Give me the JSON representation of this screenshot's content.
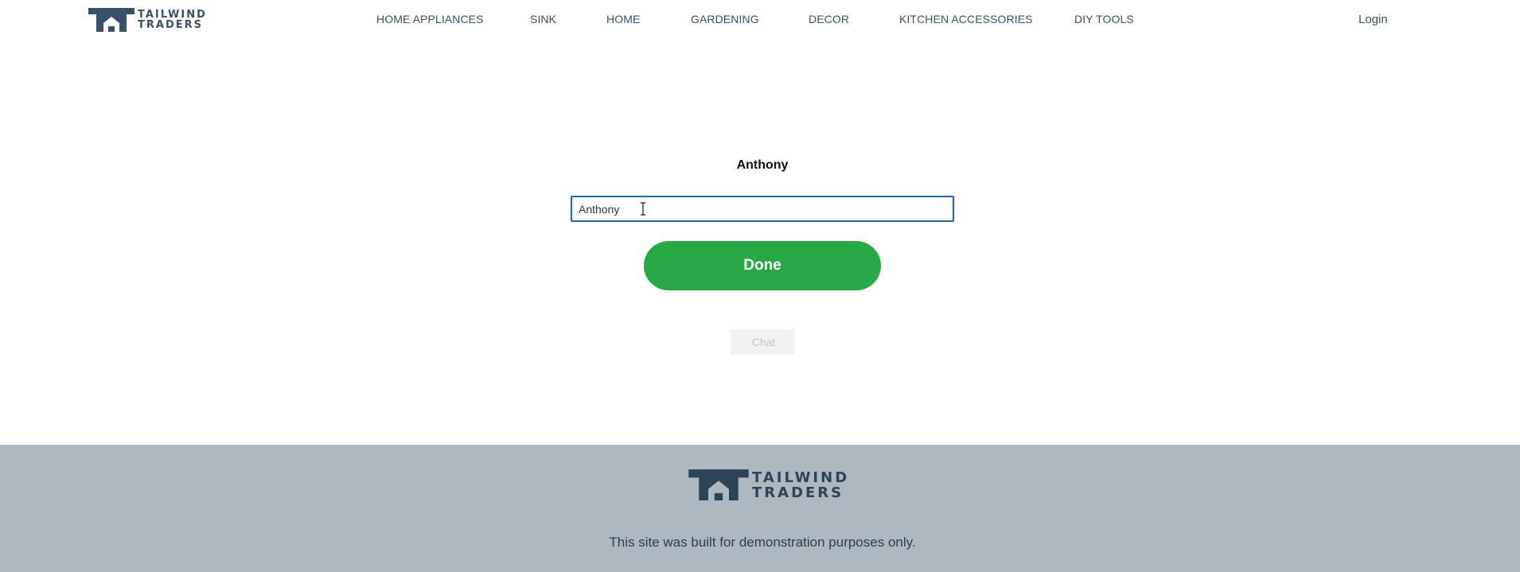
{
  "brand": {
    "name_line1": "TAILWIND",
    "name_line2": "TRADERS",
    "logo_color": "#3a5068"
  },
  "nav": {
    "items": [
      {
        "label": "HOME APPLIANCES"
      },
      {
        "label": "SINK"
      },
      {
        "label": "HOME"
      },
      {
        "label": "GARDENING"
      },
      {
        "label": "DECOR"
      },
      {
        "label": "KITCHEN ACCESSORIES"
      },
      {
        "label": "DIY TOOLS"
      }
    ],
    "login_label": "Login"
  },
  "form": {
    "heading": "Anthony",
    "name_value": "Anthony",
    "done_label": "Done",
    "done_color": "#28a745",
    "chat_label": "Chat"
  },
  "footer": {
    "brand_line1": "TAILWIND",
    "brand_line2": "TRADERS",
    "disclaimer": "This site was built for demonstration purposes only.",
    "background": "#adb8c0"
  }
}
